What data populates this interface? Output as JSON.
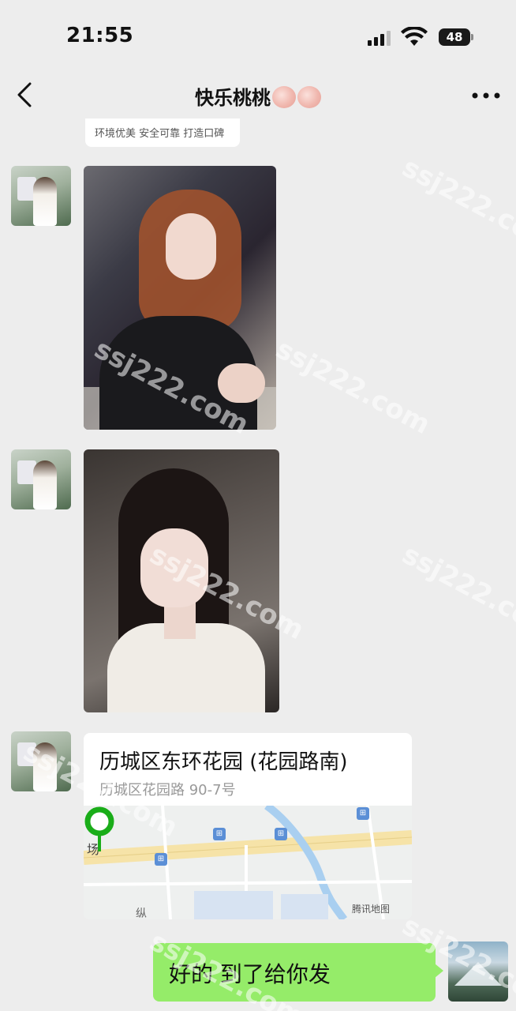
{
  "status_bar": {
    "time": "21:55",
    "battery": "48",
    "icons": [
      "signal-icon",
      "wifi-icon",
      "battery-icon"
    ]
  },
  "nav": {
    "title": "快乐桃桃",
    "back_icon": "chevron-left-icon",
    "more_icon": "more-icon"
  },
  "messages": {
    "previous_card_text": "环境优美 安全可靠 打造口碑",
    "location": {
      "title": "历城区东环花园 (花园路南)",
      "address": "历城区花园路 90-7号",
      "map_place_label": "场",
      "map_road_label": "纵",
      "map_credit": "腾讯地图"
    },
    "my_message": "好的 到了给你发"
  },
  "watermark_text": "ssj222.com",
  "colors": {
    "background": "#ededed",
    "my_bubble": "#95ec69",
    "pin": "#1aad19",
    "map_water": "#a9cff0"
  }
}
